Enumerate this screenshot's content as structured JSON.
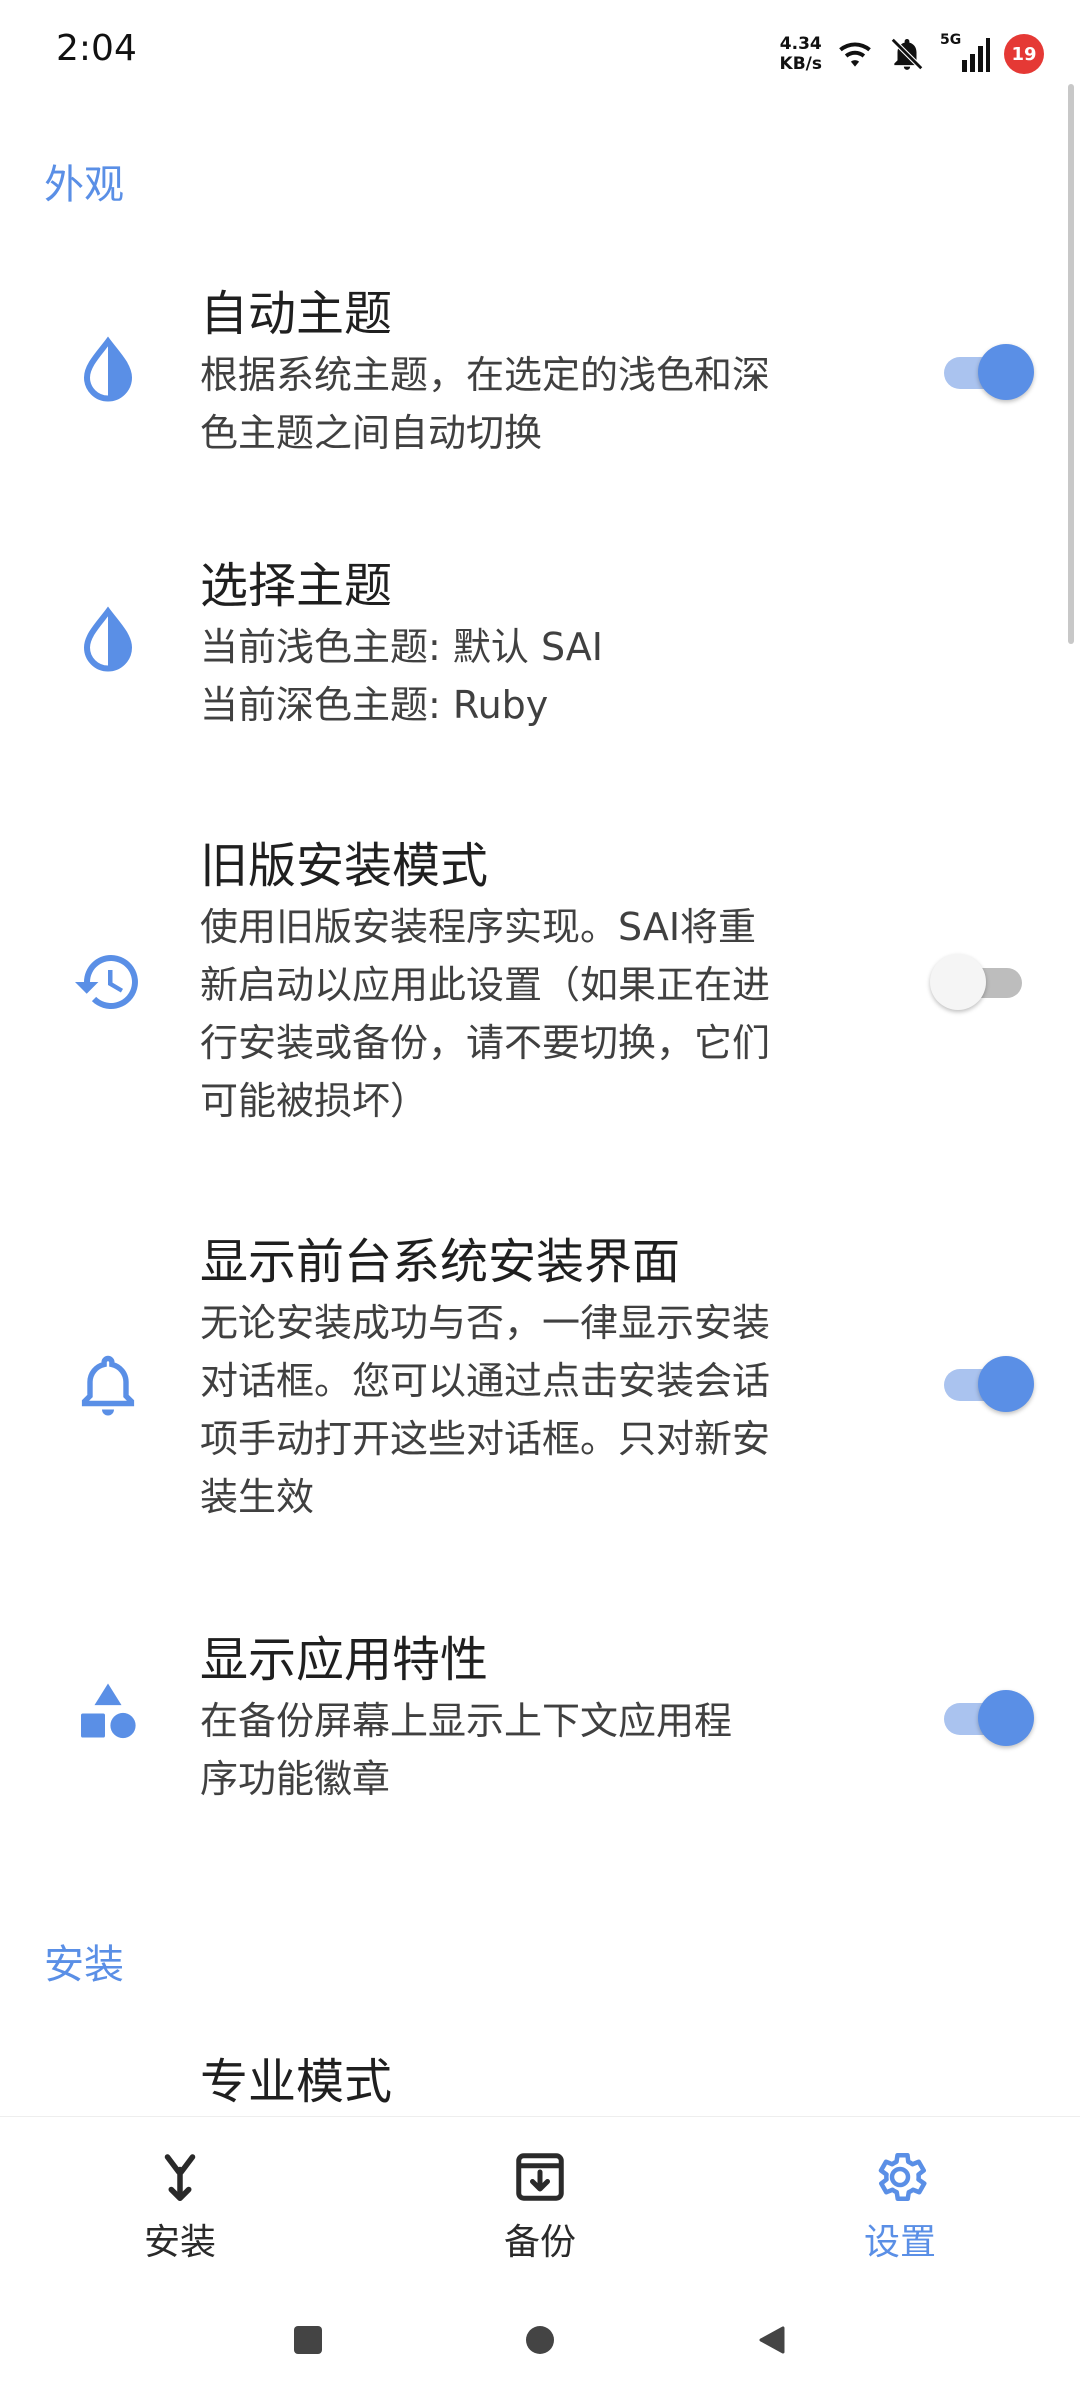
{
  "status_bar": {
    "time": "2:04",
    "net_speed_value": "4.34",
    "net_speed_unit": "KB/s",
    "network_type": "5G",
    "notification_count": "19",
    "icons": [
      "wifi-icon",
      "bell-muted-icon",
      "signal-icon"
    ]
  },
  "sections": {
    "appearance": {
      "title": "外观"
    },
    "install": {
      "title": "安装"
    }
  },
  "settings": [
    {
      "id": "auto-theme",
      "icon": "water-drop-icon",
      "title": "自动主题",
      "subtitle_lines": [
        "根据系统主题，在选定的浅色和深",
        "色主题之间自动切换"
      ],
      "toggle": true
    },
    {
      "id": "choose-theme",
      "icon": "water-drop-icon",
      "title": "选择主题",
      "subtitle_lines": [
        "当前浅色主题: 默认 SAI",
        "当前深色主题: Ruby"
      ]
    },
    {
      "id": "legacy-install",
      "icon": "history-icon",
      "title": "旧版安装模式",
      "subtitle_lines": [
        "使用旧版安装程序实现。SAI将重",
        "新启动以应用此设置（如果正在进",
        "行安装或备份，请不要切换，它们",
        "可能被损坏）"
      ],
      "toggle": false
    },
    {
      "id": "show-system-install-ui",
      "icon": "bell-icon",
      "title": "显示前台系统安装界面",
      "subtitle_lines": [
        "无论安装成功与否，一律显示安装",
        "对话框。您可以通过点击安装会话",
        "项手动打开这些对话框。只对新安",
        "装生效"
      ],
      "toggle": true
    },
    {
      "id": "show-app-features",
      "icon": "shapes-icon",
      "title": "显示应用特性",
      "subtitle_lines": [
        "在备份屏幕上显示上下文应用程",
        "序功能徽章"
      ],
      "toggle": true
    },
    {
      "id": "pro-mode",
      "title": "专业模式"
    }
  ],
  "bottom_nav": {
    "items": [
      {
        "label": "安装",
        "icon": "install-icon",
        "active": false
      },
      {
        "label": "备份",
        "icon": "backup-icon",
        "active": false
      },
      {
        "label": "设置",
        "icon": "gear-icon",
        "active": true
      }
    ]
  },
  "colors": {
    "accent": "#5a8fe6",
    "accent_light": "#aac3ef",
    "toggle_off_track": "#bdbdbd",
    "badge_red": "#e53935"
  }
}
